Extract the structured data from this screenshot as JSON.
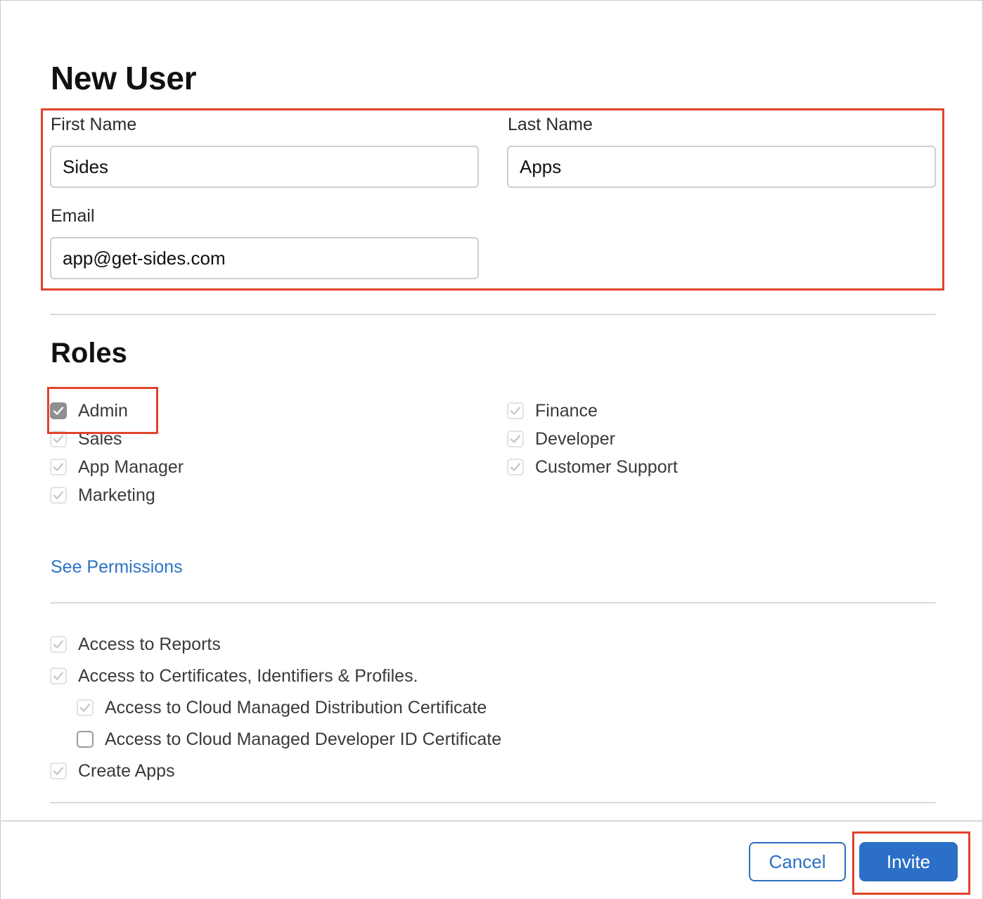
{
  "dialog": {
    "title": "New User"
  },
  "form": {
    "first_name": {
      "label": "First Name",
      "value": "Sides"
    },
    "last_name": {
      "label": "Last Name",
      "value": "Apps"
    },
    "email": {
      "label": "Email",
      "value": "app@get-sides.com"
    }
  },
  "roles": {
    "title": "Roles",
    "left": [
      {
        "label": "Admin",
        "checked": true
      },
      {
        "label": "Sales",
        "checked": true
      },
      {
        "label": "App Manager",
        "checked": true
      },
      {
        "label": "Marketing",
        "checked": true
      }
    ],
    "right": [
      {
        "label": "Finance",
        "checked": true
      },
      {
        "label": "Developer",
        "checked": true
      },
      {
        "label": "Customer Support",
        "checked": true
      }
    ],
    "see_permissions": "See Permissions"
  },
  "access": [
    {
      "label": "Access to Reports",
      "checked": true
    },
    {
      "label": "Access to Certificates, Identifiers & Profiles.",
      "checked": true
    },
    {
      "label": "Access to Cloud Managed Distribution Certificate",
      "checked": true
    },
    {
      "label": "Access to Cloud Managed Developer ID Certificate",
      "checked": false
    },
    {
      "label": "Create Apps",
      "checked": true
    }
  ],
  "footer": {
    "cancel_label": "Cancel",
    "invite_label": "Invite"
  },
  "colors": {
    "accent": "#2c6fc9",
    "highlight": "#e0442c"
  }
}
